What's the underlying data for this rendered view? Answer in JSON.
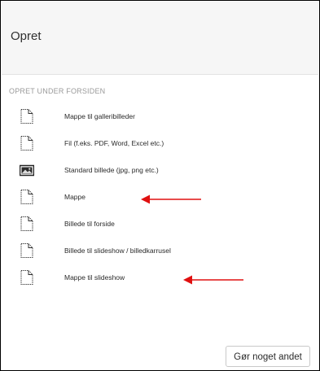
{
  "header": {
    "title": "Opret"
  },
  "section": {
    "title": "OPRET UNDER FORSIDEN"
  },
  "items": [
    {
      "label": "Mappe til galleribilleder",
      "icon": "document-icon"
    },
    {
      "label": "Fil (f.eks. PDF, Word, Excel etc.)",
      "icon": "document-icon"
    },
    {
      "label": "Standard billede (jpg, png etc.)",
      "icon": "image-icon"
    },
    {
      "label": "Mappe",
      "icon": "document-icon"
    },
    {
      "label": "Billede til forside",
      "icon": "document-icon"
    },
    {
      "label": "Billede til slideshow / billedkarrusel",
      "icon": "document-icon"
    },
    {
      "label": "Mappe til slideshow",
      "icon": "document-icon"
    }
  ],
  "annotations": {
    "arrow_color": "#e01010"
  },
  "footer": {
    "button_label": "Gør noget andet"
  }
}
